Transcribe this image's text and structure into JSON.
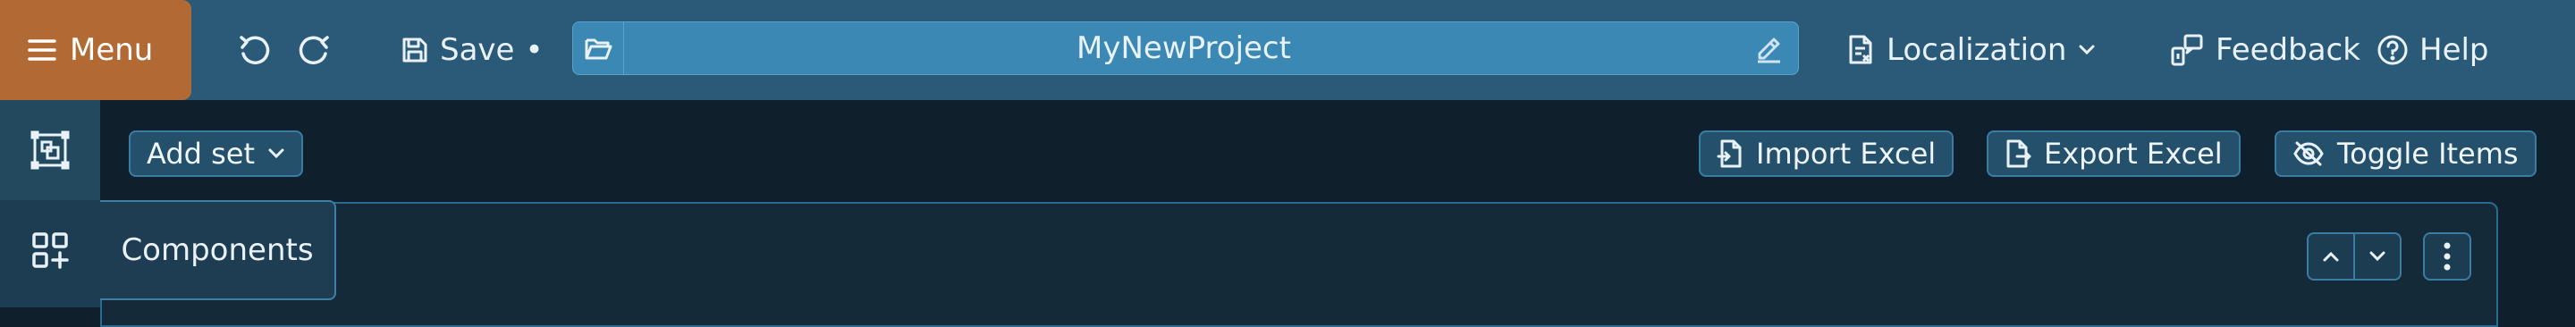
{
  "topbar": {
    "menu_label": "Menu",
    "save_label": "Save",
    "save_dirty_marker": "•",
    "project_title": "MyNewProject",
    "localization_label": "Localization",
    "feedback_label": "Feedback",
    "help_label": "Help"
  },
  "sidebar": {
    "tooltip": "Components"
  },
  "toolbar": {
    "add_set_label": "Add set",
    "import_label": "Import Excel",
    "export_label": "Export Excel",
    "toggle_label": "Toggle Items"
  },
  "icons": {
    "menu": "menu-icon",
    "undo": "undo-icon",
    "redo": "redo-icon",
    "save": "save-icon",
    "folder": "folder-open-icon",
    "edit": "pencil-icon",
    "localization": "document-language-icon",
    "feedback": "feedback-icon",
    "help": "help-icon"
  },
  "colors": {
    "topbar": "#2a5a78",
    "menu_accent": "#b16a34",
    "background": "#0f1f2b",
    "button_border": "#3a7ca4"
  }
}
